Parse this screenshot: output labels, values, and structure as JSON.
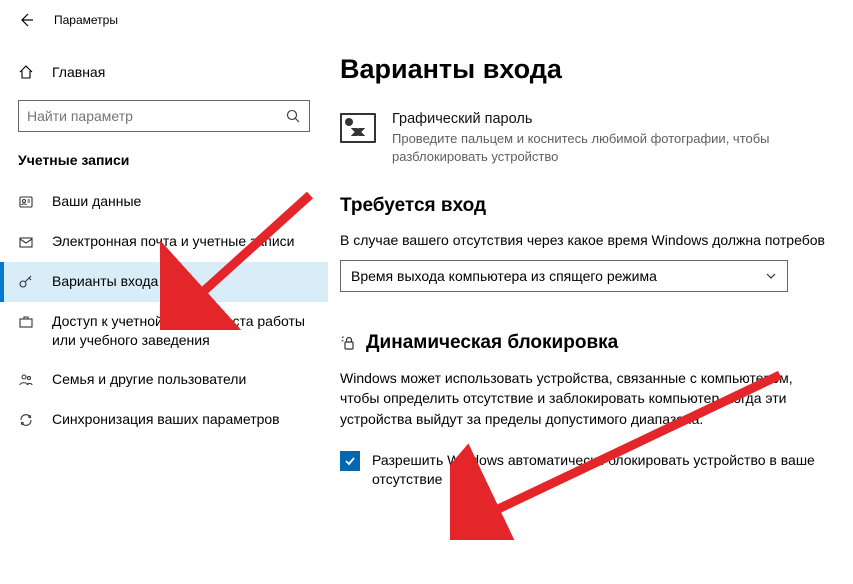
{
  "header": {
    "app_title": "Параметры"
  },
  "sidebar": {
    "home_label": "Главная",
    "search_placeholder": "Найти параметр",
    "category_title": "Учетные записи",
    "items": [
      {
        "label": "Ваши данные",
        "icon": "person-icon"
      },
      {
        "label": "Электронная почта и учетные записи",
        "icon": "mail-icon"
      },
      {
        "label": "Варианты входа",
        "icon": "key-icon",
        "selected": true
      },
      {
        "label": "Доступ к учетной записи места работы или учебного заведения",
        "icon": "briefcase-icon"
      },
      {
        "label": "Семья и другие пользователи",
        "icon": "people-icon"
      },
      {
        "label": "Синхронизация ваших параметров",
        "icon": "sync-icon"
      }
    ]
  },
  "main": {
    "page_title": "Варианты входа",
    "picture_password": {
      "title": "Графический пароль",
      "desc": "Проведите пальцем и коснитесь любимой фотографии, чтобы разблокировать устройство"
    },
    "require_signin": {
      "section_title": "Требуется вход",
      "desc": "В случае вашего отсутствия через какое время Windows должна потребов",
      "dropdown_value": "Время выхода компьютера из спящего режима"
    },
    "dynamic_lock": {
      "section_title": "Динамическая блокировка",
      "desc": "Windows может использовать устройства, связанные с компьютером, чтобы определить отсутствие и заблокировать компьютер, когда эти устройства выйдут за пределы допустимого диапазона.",
      "checkbox_label": "Разрешить Windows автоматически блокировать устройство в ваше отсутствие",
      "checked": true
    }
  }
}
